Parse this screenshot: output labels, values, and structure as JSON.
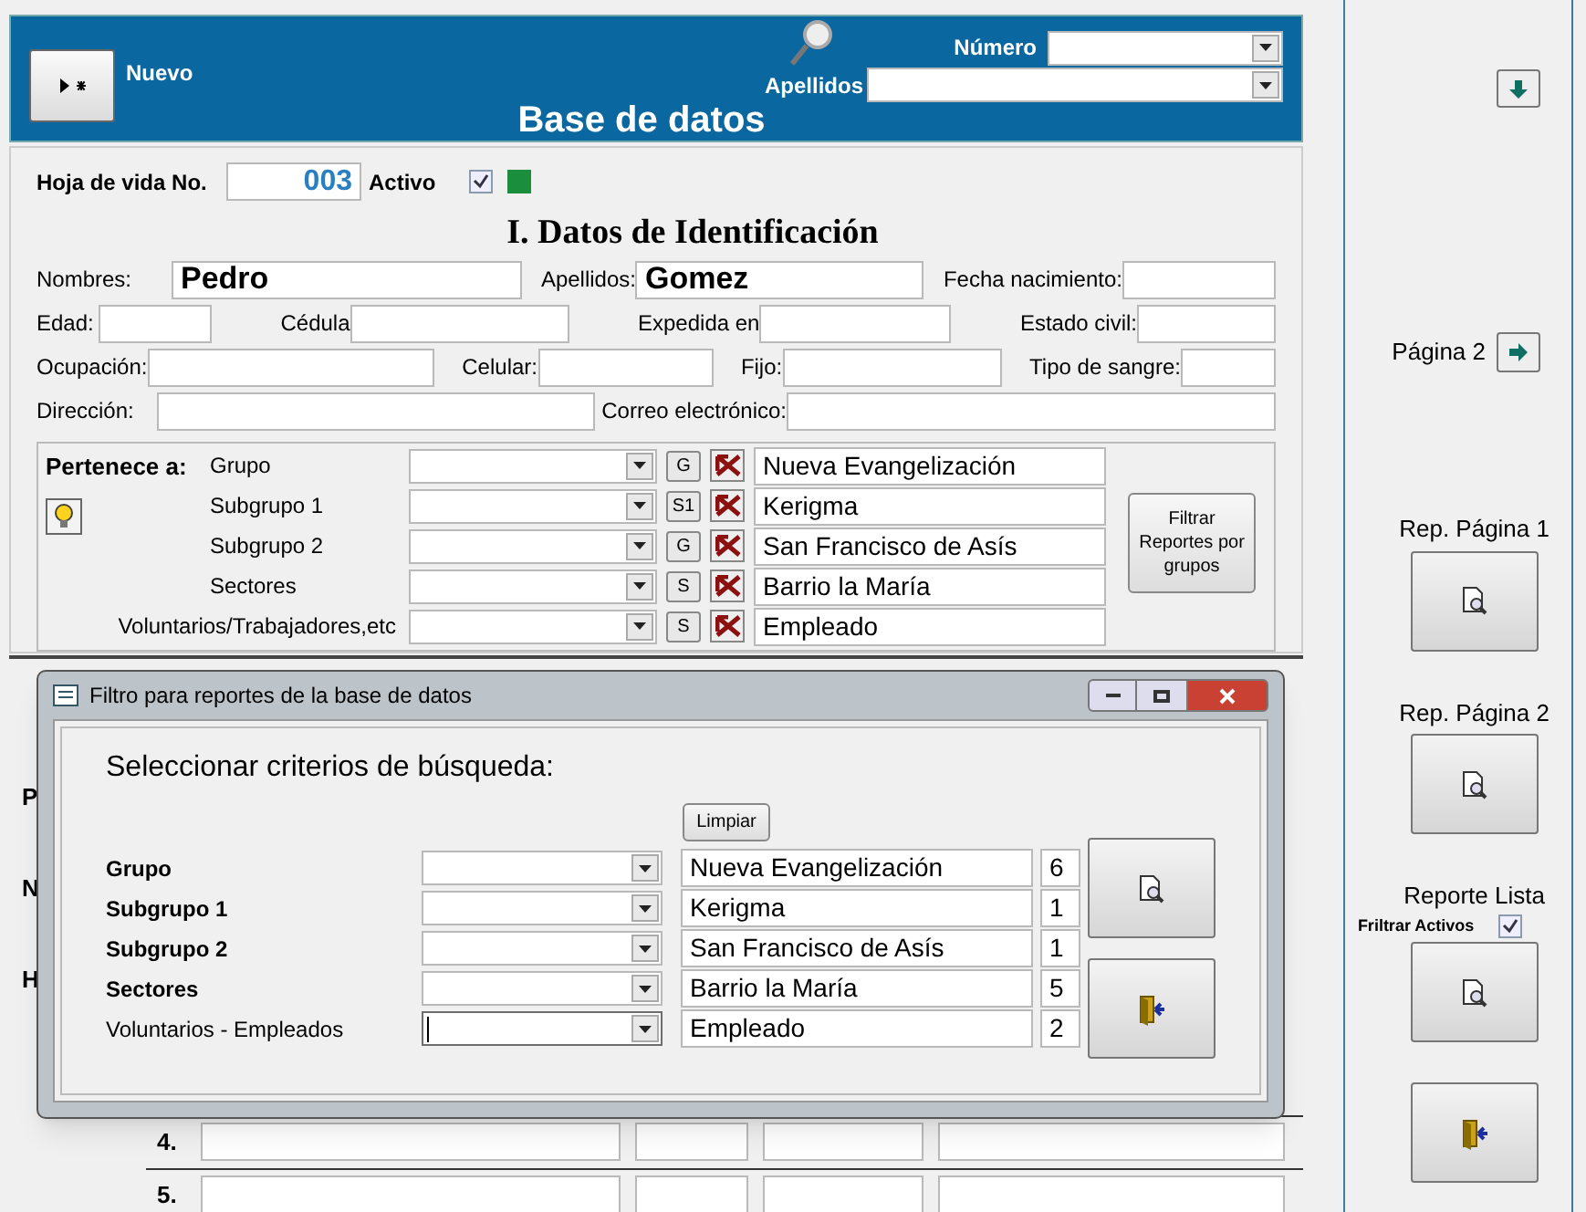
{
  "header": {
    "new_button": {
      "label": "Nuevo"
    },
    "title": "Base de datos",
    "search": [
      {
        "label": "Número"
      },
      {
        "label": "Apellidos"
      }
    ]
  },
  "record": {
    "label": "Hoja de vida No.",
    "number": "003",
    "active_label": "Activo",
    "active_checked": true
  },
  "section_title": "I. Datos de Identificación",
  "fields": [
    [
      {
        "label": "Nombres:",
        "value": "Pedro"
      },
      {
        "label": "Apellidos:",
        "value": "Gomez"
      },
      {
        "label": "Fecha nacimiento:"
      }
    ],
    [
      {
        "label": "Edad:"
      },
      {
        "label": "Cédula"
      },
      {
        "label": "Expedida en"
      },
      {
        "label": "Estado civil:"
      }
    ],
    [
      {
        "label": "Ocupación:"
      },
      {
        "label": "Celular:"
      },
      {
        "label": "Fijo:"
      },
      {
        "label": "Tipo de sangre:"
      }
    ],
    [
      {
        "label": "Dirección:"
      },
      {
        "label": "Correo electrónico:"
      }
    ]
  ],
  "groups": {
    "label": "Pertenece a:",
    "rows": [
      {
        "label": "Grupo",
        "code": "G",
        "value": "Nueva Evangelización"
      },
      {
        "label": "Subgrupo 1",
        "code": "S1",
        "value": "Kerigma"
      },
      {
        "label": "Subgrupo 2",
        "code": "G",
        "value": "San Francisco de Asís"
      },
      {
        "label": "Sectores",
        "code": "S",
        "value": "Barrio la María"
      },
      {
        "label": "Voluntarios/Trabajadores,etc",
        "code": "S",
        "value": "Empleado"
      }
    ],
    "filter_button": "Filtrar Reportes por grupos"
  },
  "background_rows": {
    "side_letters": [
      "P",
      "N",
      "H"
    ],
    "numbers": [
      "4.",
      "5."
    ]
  },
  "dialog": {
    "title": "Filtro para reportes de la base de datos",
    "heading": "Seleccionar criterios de búsqueda:",
    "clear_button": "Limpiar",
    "rows": [
      {
        "label": "Grupo",
        "value": "Nueva Evangelización",
        "count": "6",
        "focused": false
      },
      {
        "label": "Subgrupo 1",
        "value": "Kerigma",
        "count": "1",
        "focused": false
      },
      {
        "label": "Subgrupo 2",
        "value": "San Francisco de Asís",
        "count": "1",
        "focused": false
      },
      {
        "label": "Sectores",
        "value": "Barrio la María",
        "count": "5",
        "focused": false
      },
      {
        "label": "Voluntarios - Empleados",
        "value": "Empleado",
        "count": "2",
        "focused": true
      }
    ]
  },
  "side": {
    "page_label": "Página 2",
    "reports": [
      {
        "label": "Rep. Página 1"
      },
      {
        "label": "Rep. Página 2"
      },
      {
        "label": "Reporte Lista"
      }
    ],
    "filter_active": {
      "label": "Friltrar Activos",
      "checked": true
    }
  }
}
